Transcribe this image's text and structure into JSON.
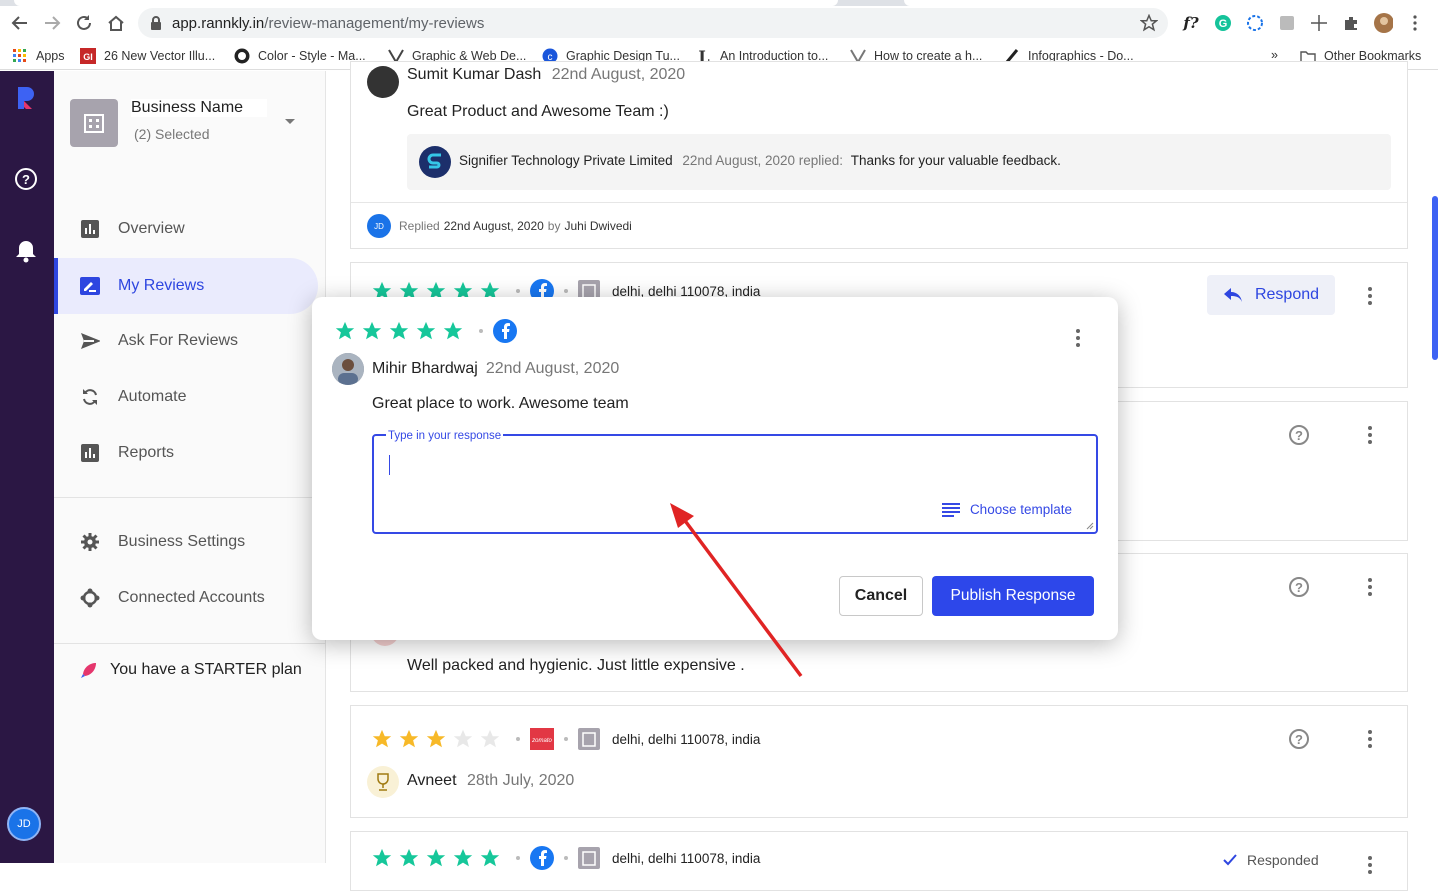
{
  "browser": {
    "url_host": "app.rannkly.in",
    "url_path": "/review-management/my-reviews",
    "bookmarks": [
      {
        "label": "Apps",
        "icon": "apps-grid-icon"
      },
      {
        "label": "26 New Vector Illu...",
        "icon": "vector-bookmark-icon"
      },
      {
        "label": "Color - Style - Ma...",
        "icon": "github-icon"
      },
      {
        "label": "Graphic & Web De...",
        "icon": "v-logo-icon"
      },
      {
        "label": "Graphic Design Tu...",
        "icon": "c-logo-icon"
      },
      {
        "label": "An Introduction to...",
        "icon": "l-logo-icon"
      },
      {
        "label": "How to create a h...",
        "icon": "v-logo-icon"
      },
      {
        "label": "Infographics - Do...",
        "icon": "infographics-icon"
      }
    ],
    "more_bookmarks": "»",
    "other_bookmarks": "Other Bookmarks"
  },
  "rail": {
    "avatar_initials": "JD"
  },
  "sidebar": {
    "business_name": "Business Name",
    "business_selected": "(2) Selected",
    "nav": [
      {
        "label": "Overview",
        "icon": "bar-chart-icon"
      },
      {
        "label": "My Reviews",
        "icon": "reviews-icon",
        "active": true
      },
      {
        "label": "Ask For Reviews",
        "icon": "send-icon"
      },
      {
        "label": "Automate",
        "icon": "sync-icon"
      },
      {
        "label": "Reports",
        "icon": "report-icon"
      }
    ],
    "settings": [
      {
        "label": "Business Settings",
        "icon": "gear-icon"
      },
      {
        "label": "Connected Accounts",
        "icon": "connected-icon"
      }
    ],
    "plan_text": "You have a STARTER plan"
  },
  "reviews": {
    "top": {
      "reviewer": "Sumit Kumar Dash",
      "date": "22nd August, 2020",
      "text": "Great Product and Awesome Team :)",
      "reply_company": "Signifier Technology Private Limited",
      "reply_meta": "22nd August, 2020 replied:",
      "reply_text": "Thanks for your valuable feedback.",
      "replied_prefix": "Replied",
      "replied_date": "22nd August, 2020",
      "replied_by": "by",
      "replied_name": "Juhi Dwivedi",
      "replied_initials": "JD"
    },
    "second": {
      "rating": 5,
      "location": "delhi, delhi 110078, india",
      "respond_label": "Respond"
    },
    "fourth": {
      "text": "Well packed and hygienic. Just little expensive ."
    },
    "fifth": {
      "rating": 3,
      "location": "delhi, delhi 110078, india",
      "reviewer": "Avneet",
      "date": "28th July, 2020"
    },
    "sixth": {
      "rating": 5,
      "location": "delhi, delhi 110078, india",
      "status": "Responded"
    }
  },
  "modal": {
    "rating": 5,
    "reviewer": "Mihir Bhardwaj",
    "date": "22nd August, 2020",
    "text": "Great place to work. Awesome team",
    "response_label": "Type in your response",
    "response_value": "",
    "template_label": "Choose template",
    "cancel_label": "Cancel",
    "publish_label": "Publish Response"
  },
  "colors": {
    "accent": "#2d47ea",
    "star_green": "#16c79a",
    "star_yellow": "#f7b928",
    "rail": "#2b1744",
    "arrow": "#e02424"
  }
}
